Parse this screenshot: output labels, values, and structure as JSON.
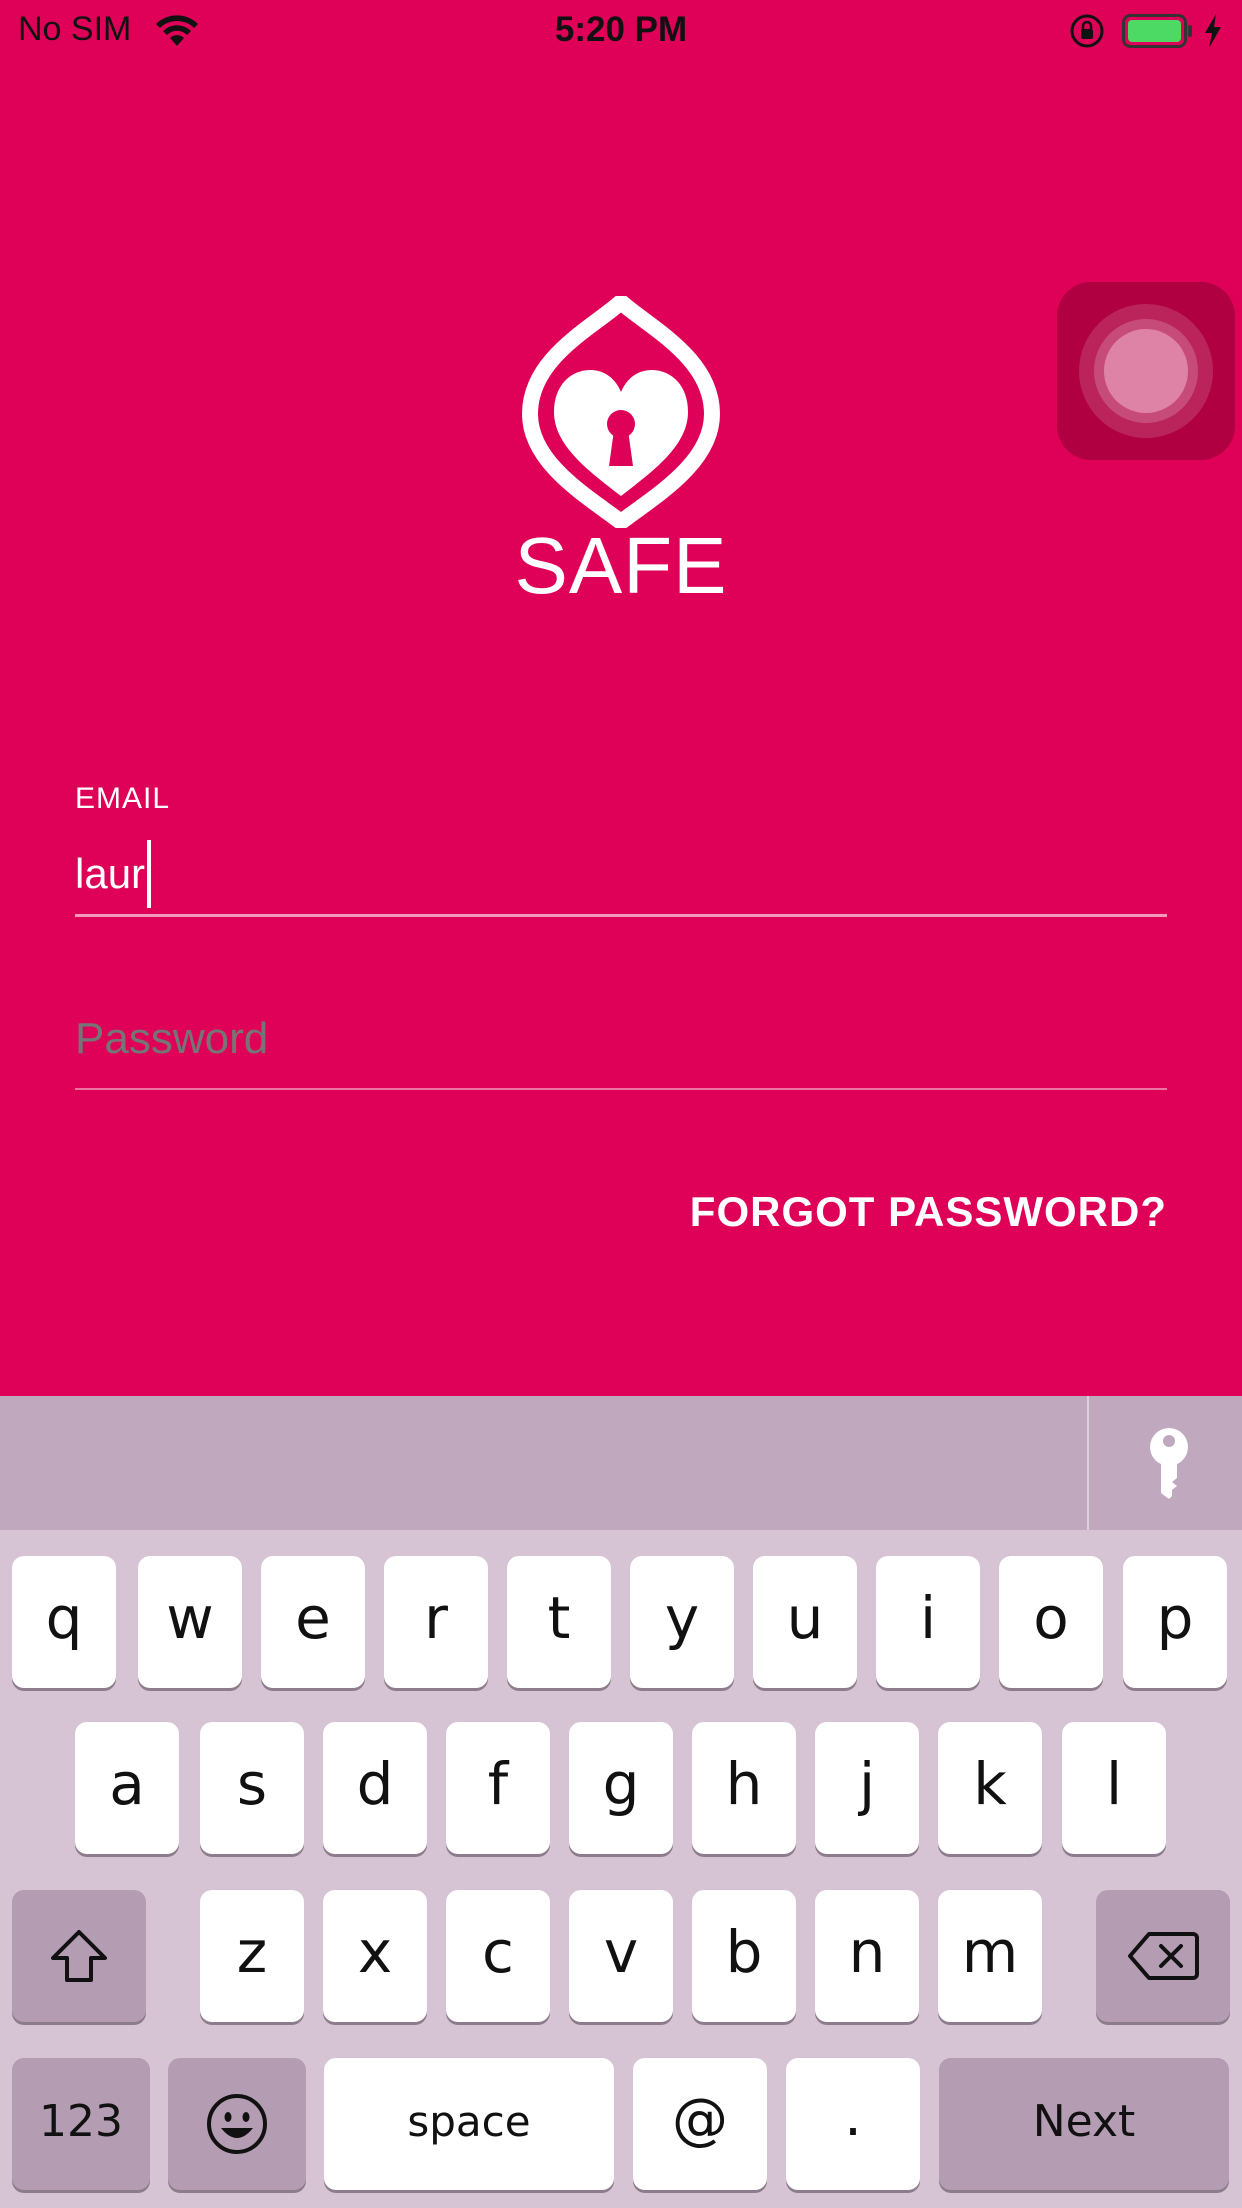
{
  "status_bar": {
    "carrier": "No SIM",
    "time": "5:20 PM",
    "icons": [
      "wifi-icon",
      "rotation-lock-icon",
      "battery-icon",
      "charging-bolt-icon"
    ]
  },
  "app": {
    "name": "SAFE",
    "logo_icon": "heart-keyhole-lock-icon"
  },
  "form": {
    "email_label": "EMAIL",
    "email_value": "laur",
    "password_placeholder": "Password",
    "forgot_password": "FORGOT PASSWORD?"
  },
  "keyboard": {
    "row1": [
      "q",
      "w",
      "e",
      "r",
      "t",
      "y",
      "u",
      "i",
      "o",
      "p"
    ],
    "row2": [
      "a",
      "s",
      "d",
      "f",
      "g",
      "h",
      "j",
      "k",
      "l"
    ],
    "row3": [
      "z",
      "x",
      "c",
      "v",
      "b",
      "n",
      "m"
    ],
    "numbers_key": "123",
    "space_key": "space",
    "at_key": "@",
    "period_key": ".",
    "return_key": "Next",
    "icons": [
      "key-icon",
      "shift-icon",
      "backspace-icon",
      "emoji-icon"
    ]
  },
  "colors": {
    "brand": "#DF0157",
    "keyboard_bg": "#D6C3D3",
    "keyboard_toolbar": "#C0A9BE"
  }
}
